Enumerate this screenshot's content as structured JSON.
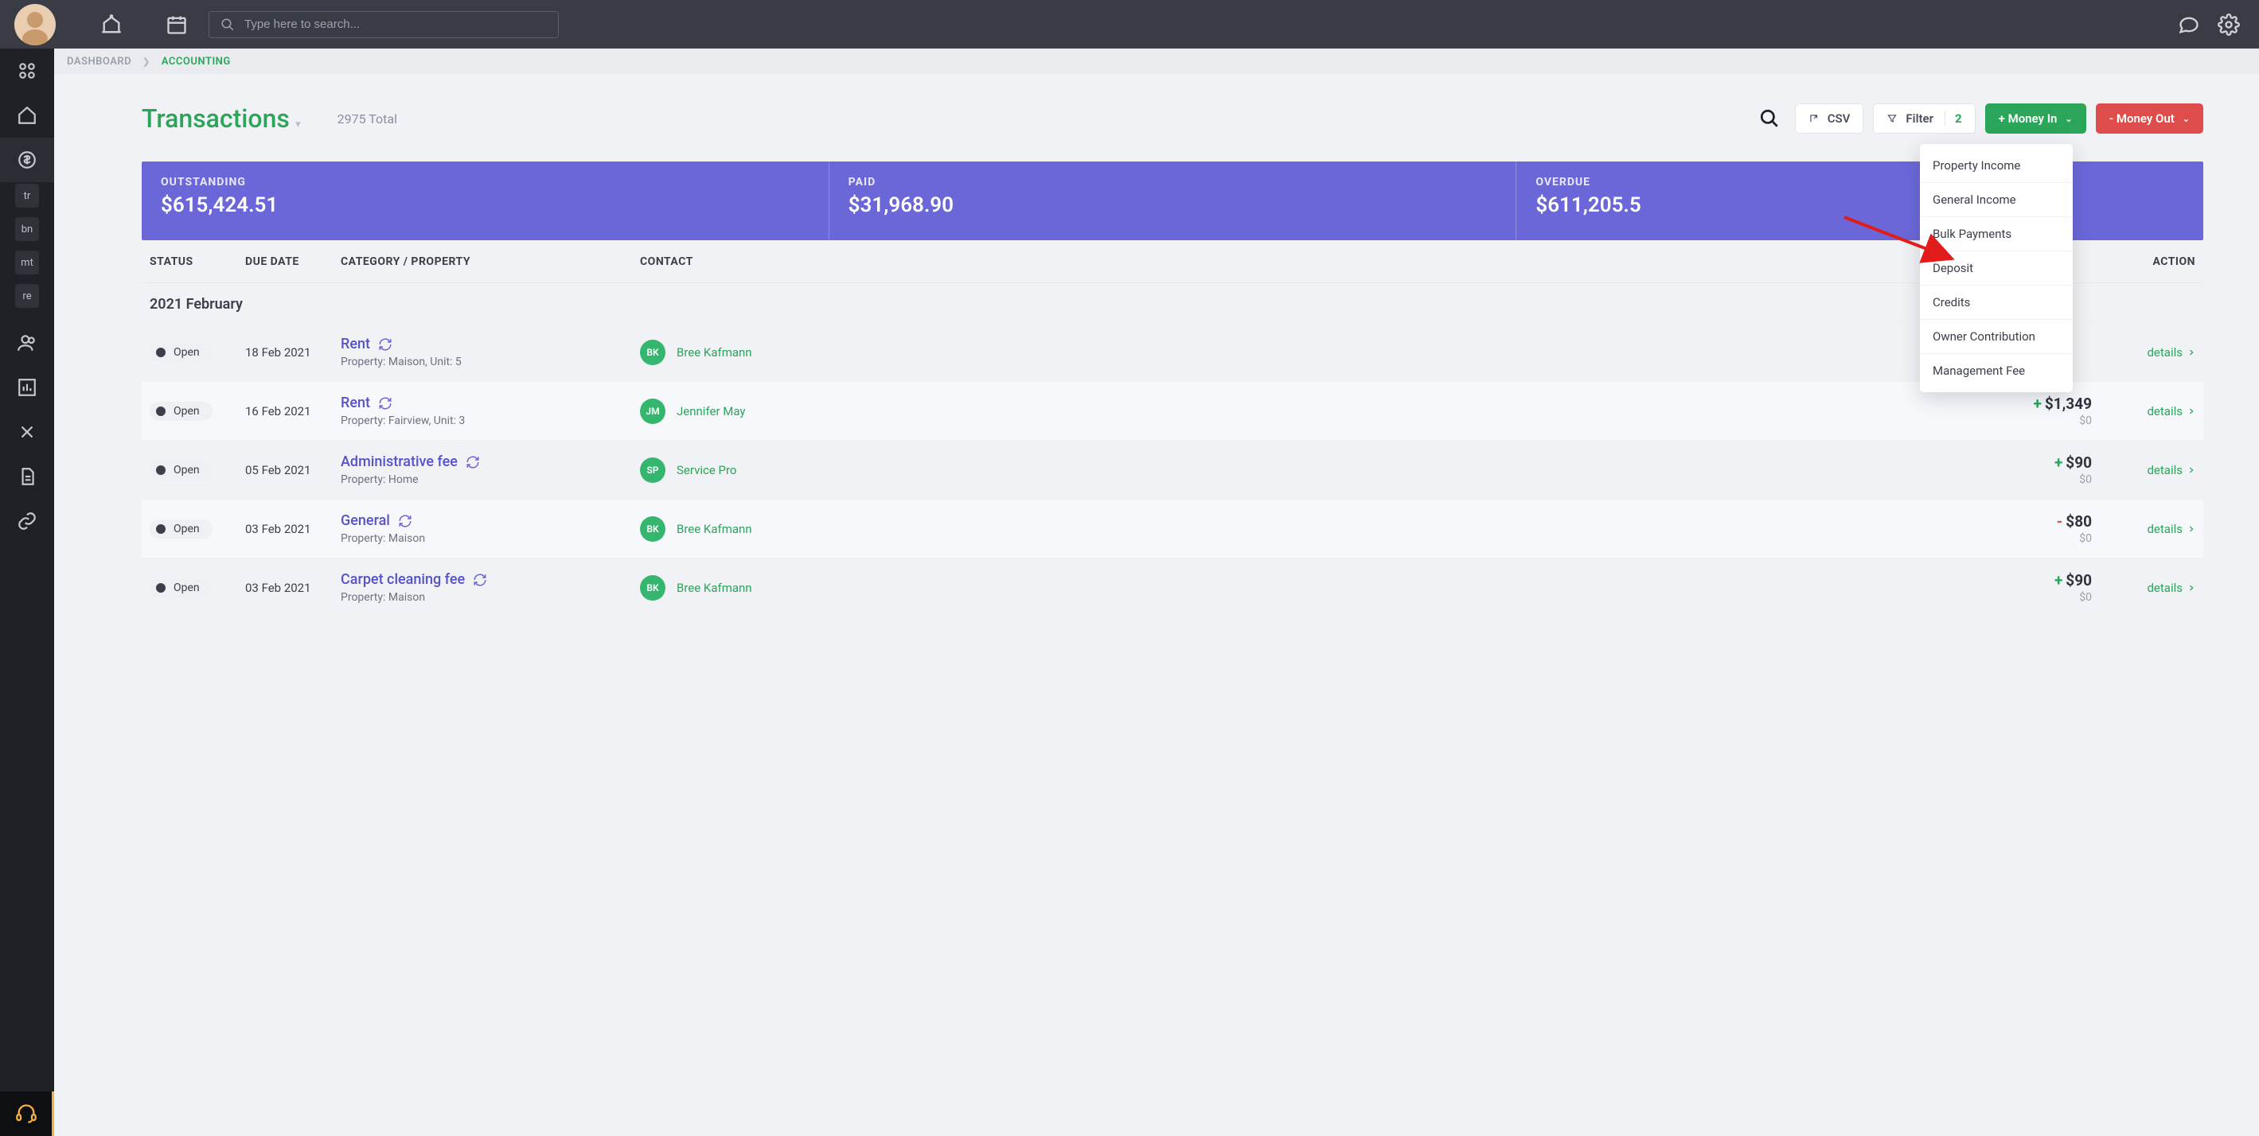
{
  "topbar": {
    "search_placeholder": "Type here to search..."
  },
  "breadcrumb": {
    "dashboard": "DASHBOARD",
    "accounting": "ACCOUNTING"
  },
  "header": {
    "title": "Transactions",
    "total": "2975 Total",
    "csv": "CSV",
    "filter": "Filter",
    "filter_count": "2",
    "money_in": "+  Money In",
    "money_out": "-  Money Out"
  },
  "dropdown": {
    "items": [
      "Property Income",
      "General Income",
      "Bulk Payments",
      "Deposit",
      "Credits",
      "Owner Contribution",
      "Management Fee"
    ]
  },
  "summary": {
    "outstanding_label": "OUTSTANDING",
    "outstanding_value": "$615,424.51",
    "paid_label": "PAID",
    "paid_value": "$31,968.90",
    "overdue_label": "OVERDUE",
    "overdue_value": "$611,205.5"
  },
  "columns": {
    "status": "STATUS",
    "due_date": "DUE DATE",
    "category": "CATEGORY / PROPERTY",
    "contact": "CONTACT",
    "action": "ACTION"
  },
  "group": "2021 February",
  "status_label": "Open",
  "details_label": "details",
  "sidebar_subs": [
    "tr",
    "bn",
    "mt",
    "re"
  ],
  "rows": [
    {
      "date": "18 Feb 2021",
      "title": "Rent",
      "subtitle": "Property: Maison, Unit: 5",
      "contact_initials": "BK",
      "contact_name": "Bree Kafmann",
      "contact_color": "#35b66f",
      "sign": "",
      "amount": "",
      "sub_amount": ""
    },
    {
      "date": "16 Feb 2021",
      "title": "Rent",
      "subtitle": "Property: Fairview, Unit: 3",
      "contact_initials": "JM",
      "contact_name": "Jennifer May",
      "contact_color": "#35b66f",
      "sign": "+",
      "amount": "$1,349",
      "sub_amount": "$0"
    },
    {
      "date": "05 Feb 2021",
      "title": "Administrative fee",
      "subtitle": "Property: Home",
      "contact_initials": "SP",
      "contact_name": "Service Pro",
      "contact_color": "#35b66f",
      "sign": "+",
      "amount": "$90",
      "sub_amount": "$0"
    },
    {
      "date": "03 Feb 2021",
      "title": "General",
      "subtitle": "Property: Maison",
      "contact_initials": "BK",
      "contact_name": "Bree Kafmann",
      "contact_color": "#35b66f",
      "sign": "-",
      "amount": "$80",
      "sub_amount": "$0"
    },
    {
      "date": "03 Feb 2021",
      "title": "Carpet cleaning fee",
      "subtitle": "Property: Maison",
      "contact_initials": "BK",
      "contact_name": "Bree Kafmann",
      "contact_color": "#35b66f",
      "sign": "+",
      "amount": "$90",
      "sub_amount": "$0"
    }
  ]
}
